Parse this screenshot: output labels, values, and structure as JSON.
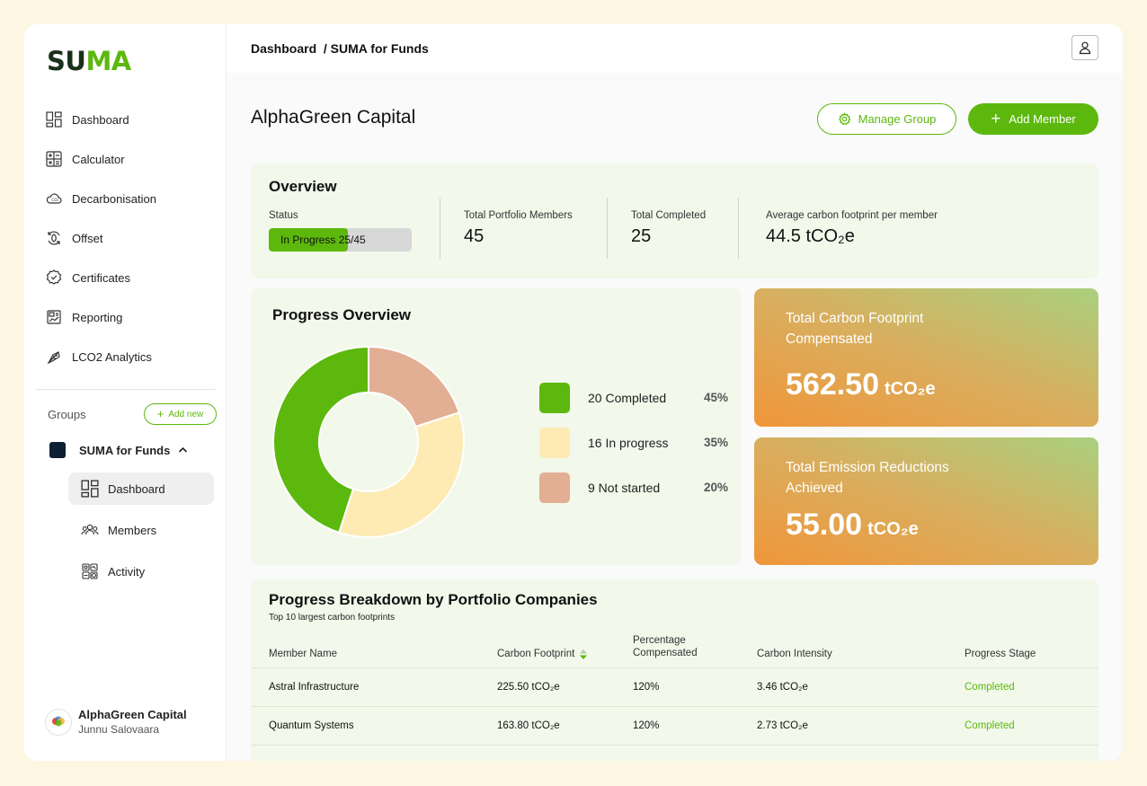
{
  "brand": {
    "part1": "SU",
    "part2": "MA"
  },
  "nav": [
    {
      "label": "Dashboard",
      "icon": "dashboard-icon"
    },
    {
      "label": "Calculator",
      "icon": "calculator-icon"
    },
    {
      "label": "Decarbonisation",
      "icon": "cloud-co2-icon"
    },
    {
      "label": "Offset",
      "icon": "offset-cycle-icon"
    },
    {
      "label": "Certificates",
      "icon": "certificate-check-icon"
    },
    {
      "label": "Reporting",
      "icon": "report-chart-icon"
    },
    {
      "label": "LCO2 Analytics",
      "icon": "analytics-icon"
    }
  ],
  "groups": {
    "label": "Groups",
    "add_new": "Add new",
    "item": "SUMA for Funds",
    "sub_items": [
      "Dashboard",
      "Members",
      "Activity"
    ]
  },
  "user": {
    "company": "AlphaGreen Capital",
    "name": "Junnu Salovaara"
  },
  "breadcrumb": {
    "root": "Dashboard",
    "current": "/ SUMA for Funds"
  },
  "page": {
    "title": "AlphaGreen Capital",
    "manage_group": "Manage Group",
    "add_member": "Add Member"
  },
  "overview": {
    "title": "Overview",
    "status_label": "Status",
    "progress_text": "In Progress 25/45",
    "progress_fraction": 0.556,
    "members_label": "Total Portfolio Members",
    "members_value": "45",
    "completed_label": "Total Completed",
    "completed_value": "25",
    "avg_label": "Average carbon footprint per member",
    "avg_value": "44.5 tCO₂e"
  },
  "progress_overview": {
    "title": "Progress Overview"
  },
  "chart_data": {
    "type": "pie",
    "categories": [
      "Completed",
      "In progress",
      "Not started"
    ],
    "values": [
      45,
      35,
      20
    ],
    "labels": [
      "20 Completed",
      "16 In progress",
      "9 Not started"
    ],
    "pct_labels": [
      "45%",
      "35%",
      "20%"
    ],
    "colors": [
      "#5cb80d",
      "#fdebb3",
      "#e2ae94"
    ]
  },
  "compensated": {
    "title": "Total Carbon Footprint Compensated",
    "value": "562.50",
    "unit": "tCO₂e"
  },
  "reductions": {
    "title": "Total Emission Reductions Achieved",
    "value": "55.00",
    "unit": "tCO₂e"
  },
  "breakdown": {
    "title": "Progress Breakdown by Portfolio Companies",
    "subtitle": "Top 10 largest carbon footprints",
    "columns": [
      "Member Name",
      "Carbon Footprint",
      "Percentage Compensated",
      "Carbon Intensity",
      "Progress Stage"
    ],
    "rows": [
      [
        "Astral Infrastructure",
        "225.50 tCO₂e",
        "120%",
        "3.46 tCO₂e",
        "Completed"
      ],
      [
        "Quantum Systems",
        "163.80 tCO₂e",
        "120%",
        "2.73 tCO₂e",
        "Completed"
      ]
    ]
  }
}
